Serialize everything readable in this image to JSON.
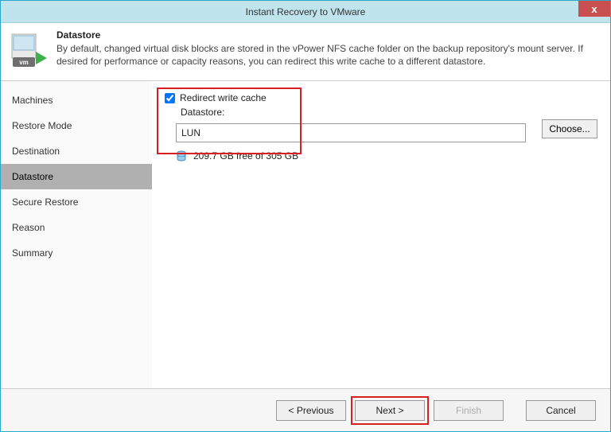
{
  "window": {
    "title": "Instant Recovery to VMware",
    "close_glyph": "x"
  },
  "header": {
    "title": "Datastore",
    "description": "By default, changed virtual disk blocks are stored in the vPower NFS cache folder on the backup repository's mount server. If desired for performance or capacity reasons, you can redirect this write cache to a different datastore."
  },
  "sidebar": {
    "steps": [
      {
        "label": "Machines",
        "active": false
      },
      {
        "label": "Restore Mode",
        "active": false
      },
      {
        "label": "Destination",
        "active": false
      },
      {
        "label": "Datastore",
        "active": true
      },
      {
        "label": "Secure Restore",
        "active": false
      },
      {
        "label": "Reason",
        "active": false
      },
      {
        "label": "Summary",
        "active": false
      }
    ]
  },
  "content": {
    "redirect_checkbox_label": "Redirect write cache",
    "redirect_checked": true,
    "datastore_label": "Datastore:",
    "datastore_value": "LUN",
    "choose_label": "Choose...",
    "freespace": "209.7 GB free of 305 GB"
  },
  "footer": {
    "previous": "< Previous",
    "next": "Next >",
    "finish": "Finish",
    "cancel": "Cancel"
  },
  "colors": {
    "titlebar_bg": "#bfe4ee",
    "close_bg": "#c85050",
    "highlight_border": "#d52121",
    "active_step_bg": "#b0b0b0",
    "brand_green": "#3eb049",
    "db_blue": "#3b8fd1"
  }
}
